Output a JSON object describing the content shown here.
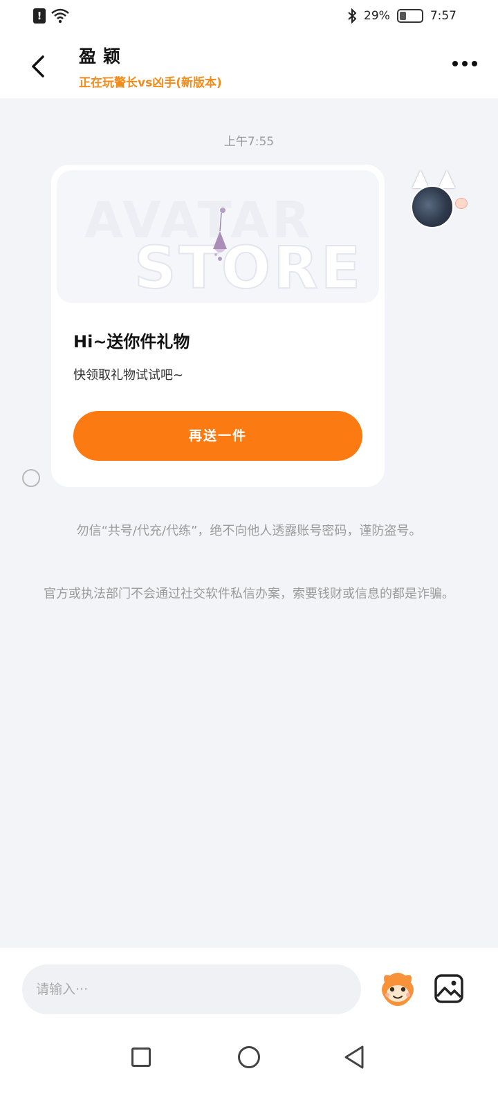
{
  "status_bar": {
    "battery_percent": "29%",
    "time": "7:57"
  },
  "header": {
    "contact_name": "盈颖",
    "contact_status": "正在玩警长vs凶手(新版本)"
  },
  "chat": {
    "timestamp": "上午7:55",
    "gift_card": {
      "banner_line1": "AVATAR",
      "banner_line2": "STORE",
      "title": "Hi~送你件礼物",
      "description": "快领取礼物试试吧~",
      "button_label": "再送一件"
    },
    "notices": [
      "勿信“共号/代充/代练”，绝不向他人透露账号密码，谨防盗号。",
      "官方或执法部门不会通过社交软件私信办案，索要钱财或信息的都是诈骗。"
    ]
  },
  "input": {
    "placeholder": "请输入···"
  },
  "colors": {
    "accent": "#fb7a12",
    "status_text": "#f08b1c",
    "background": "#f3f4f8"
  }
}
